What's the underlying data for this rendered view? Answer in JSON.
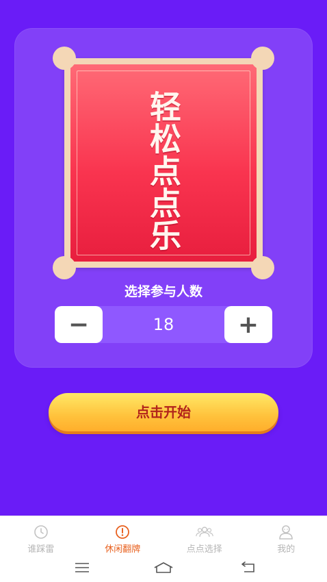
{
  "poster": {
    "title": "轻松点点乐"
  },
  "participants": {
    "label": "选择参与人数",
    "minus_symbol": "−",
    "plus_symbol": "+",
    "value": "18"
  },
  "start_button": {
    "label": "点击开始"
  },
  "tabbar": {
    "items": [
      {
        "label": "谁踩雷",
        "icon": "clock-icon",
        "active": false
      },
      {
        "label": "休闲翻牌",
        "icon": "alert-icon",
        "active": true
      },
      {
        "label": "点点选择",
        "icon": "people-icon",
        "active": false
      },
      {
        "label": "我的",
        "icon": "person-icon",
        "active": false
      }
    ]
  },
  "colors": {
    "background": "#6a1cf7",
    "accent": "#e8611f",
    "start_text": "#b2241b"
  }
}
